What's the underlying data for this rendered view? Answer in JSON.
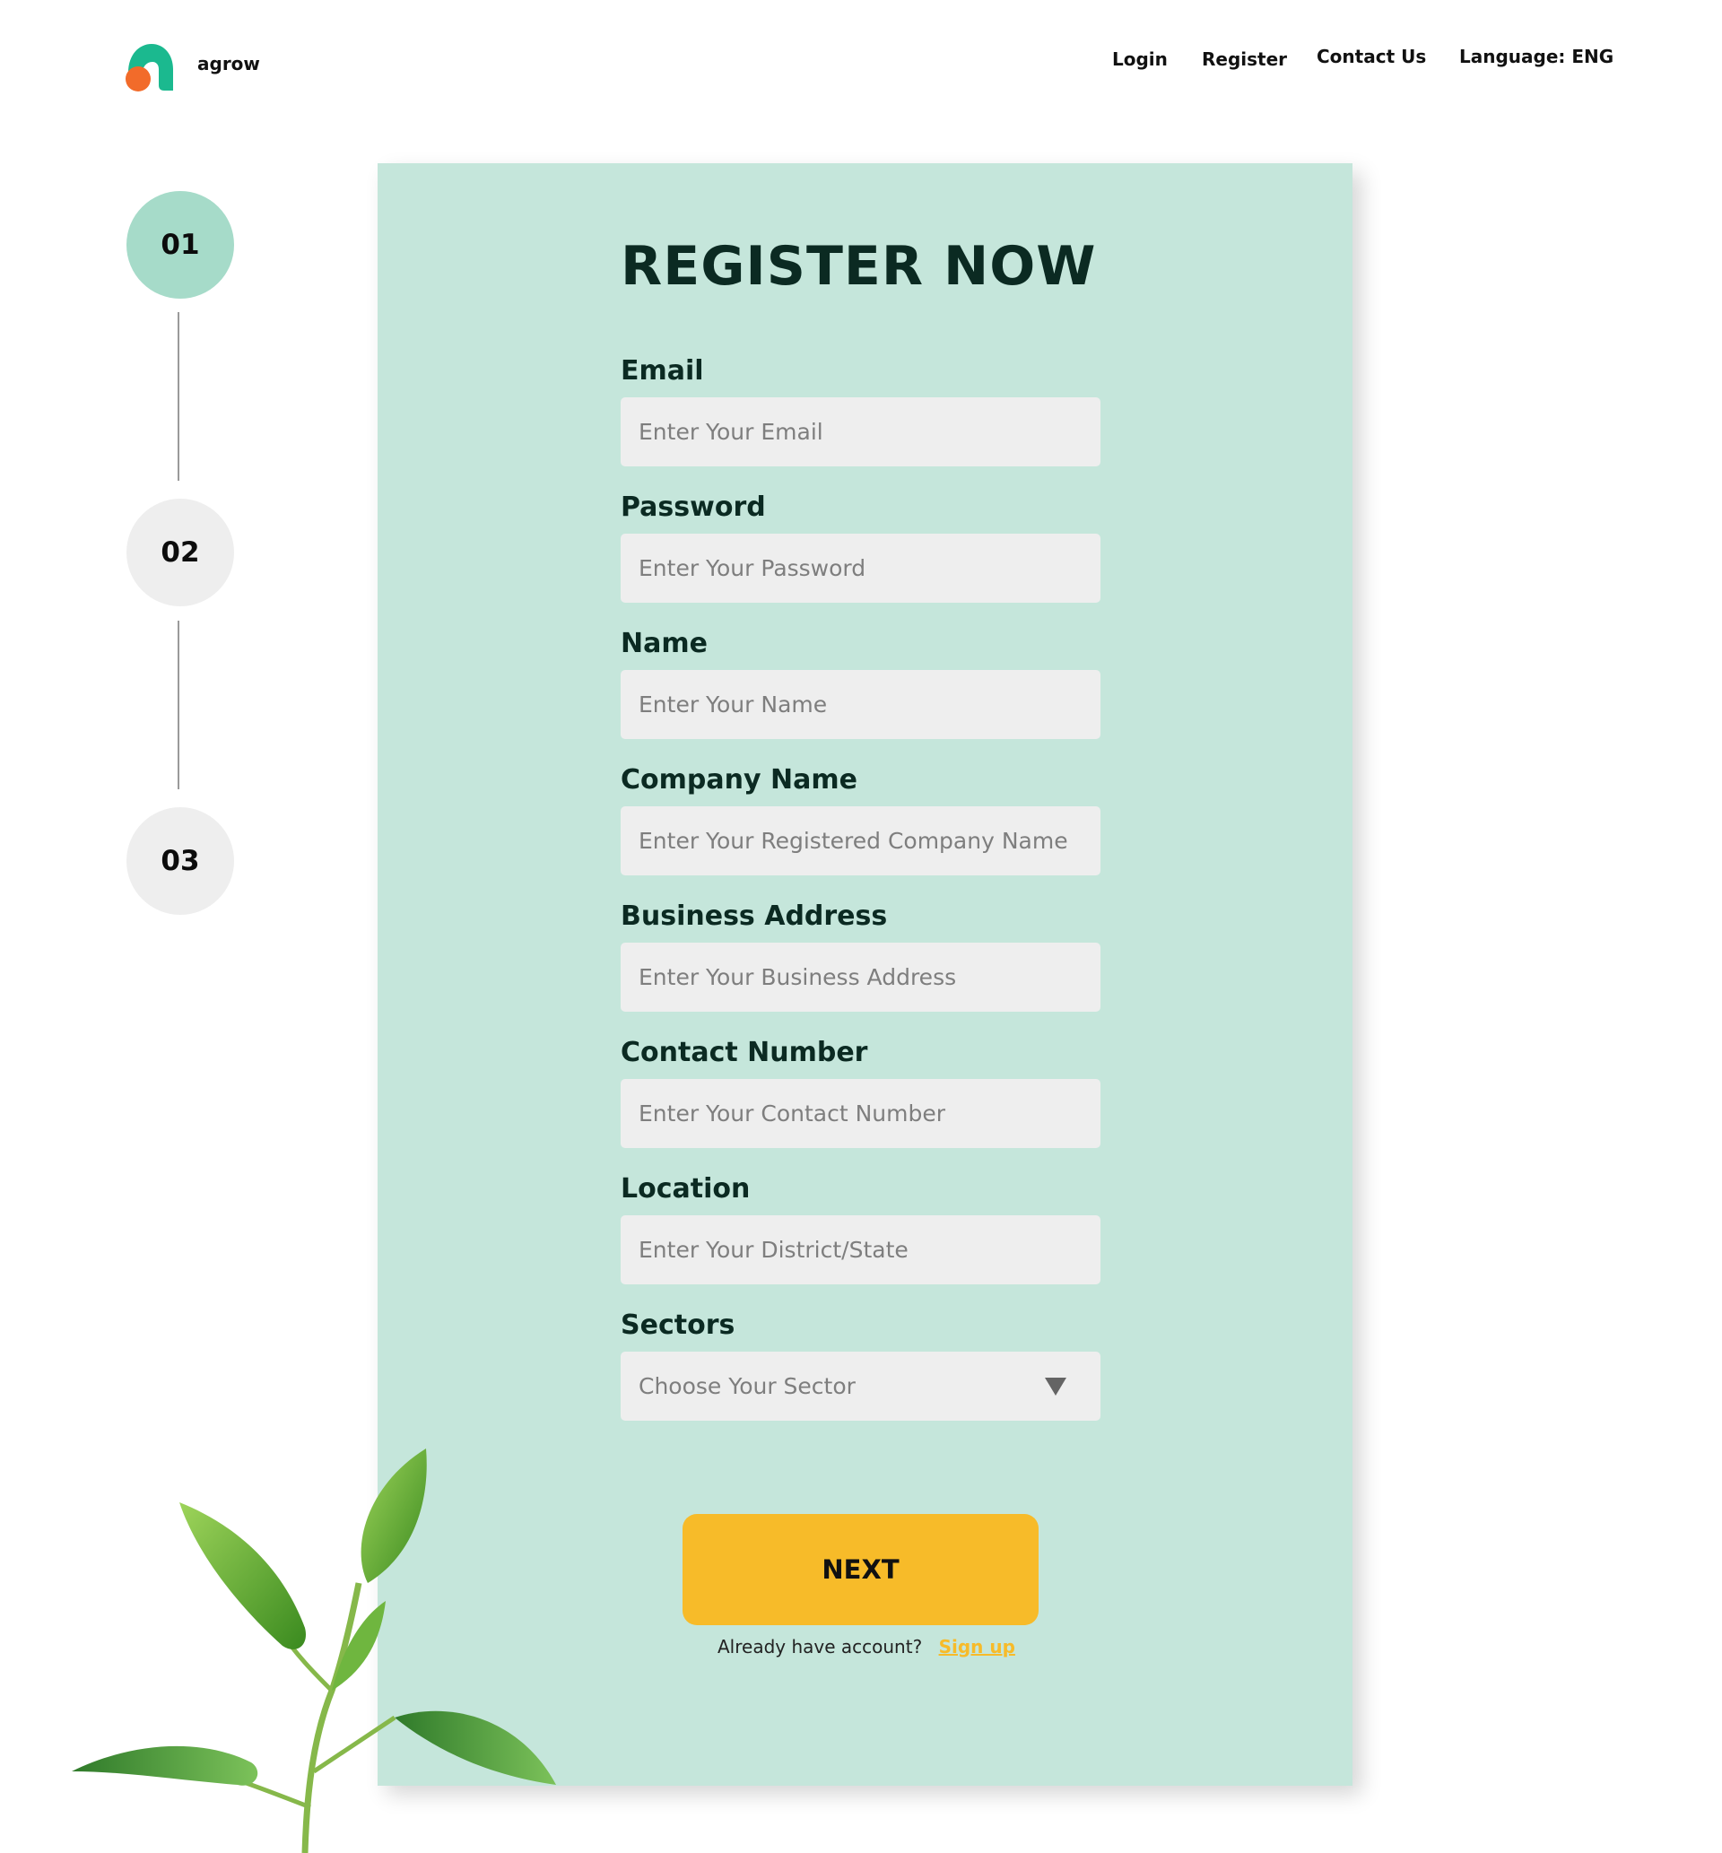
{
  "brand": {
    "name": "agrow"
  },
  "nav": {
    "login": "Login",
    "register": "Register",
    "contact": "Contact Us",
    "language": "Language: ENG"
  },
  "steps": [
    {
      "label": "01",
      "state": "active"
    },
    {
      "label": "02",
      "state": "inactive"
    },
    {
      "label": "03",
      "state": "inactive"
    }
  ],
  "form": {
    "title": "REGISTER NOW",
    "fields": {
      "email": {
        "label": "Email",
        "placeholder": "Enter Your Email",
        "value": ""
      },
      "password": {
        "label": "Password",
        "placeholder": "Enter Your Password",
        "value": ""
      },
      "name": {
        "label": "Name",
        "placeholder": "Enter Your Name",
        "value": ""
      },
      "company": {
        "label": "Company Name",
        "placeholder": "Enter Your Registered Company Name",
        "value": ""
      },
      "address": {
        "label": "Business Address",
        "placeholder": "Enter Your Business Address",
        "value": ""
      },
      "contact": {
        "label": "Contact Number",
        "placeholder": "Enter Your Contact Number",
        "value": ""
      },
      "location": {
        "label": "Location",
        "placeholder": "Enter Your District/State",
        "value": ""
      },
      "sectors": {
        "label": "Sectors",
        "placeholder": "Choose Your Sector",
        "icon": "caret-down-icon"
      }
    },
    "next_button": "NEXT",
    "footer_text": "Already have account?",
    "signup_link": "Sign up"
  },
  "colors": {
    "card_bg": "#c5e6db",
    "step_active": "#a6dbc9",
    "step_inactive": "#eeeeee",
    "accent_yellow": "#f7bb29",
    "title_dark": "#0b2a22",
    "logo_green": "#1bb98f",
    "logo_orange": "#f26b2a"
  }
}
